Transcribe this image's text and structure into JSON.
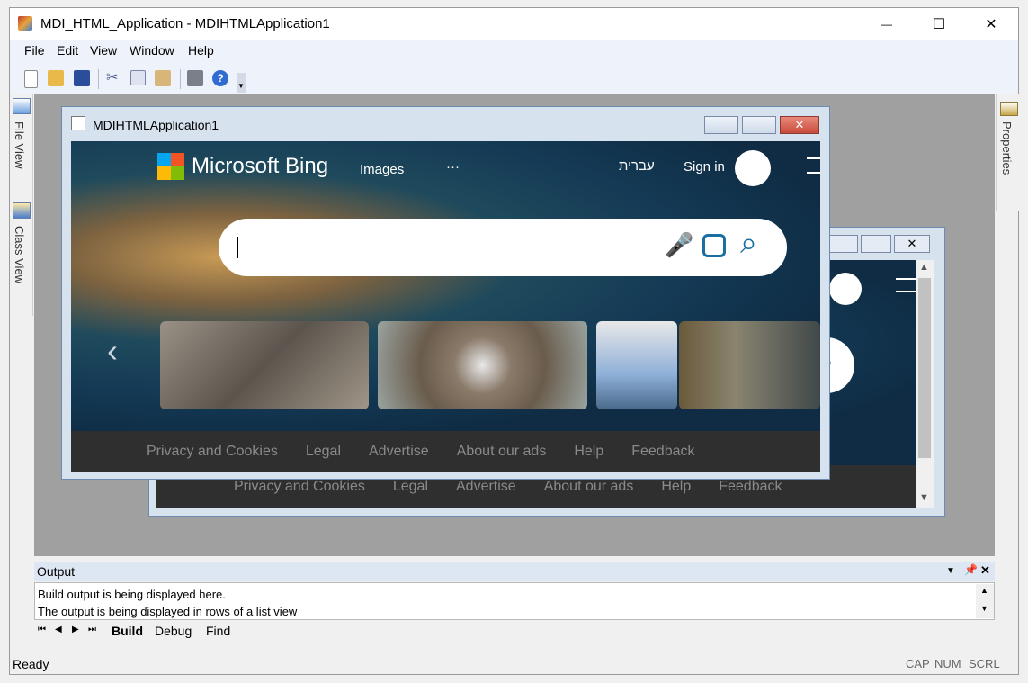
{
  "app": {
    "title": "MDI_HTML_Application - MDIHTMLApplication1",
    "minimize_glyph": "—",
    "maximize_glyph": "☐",
    "close_glyph": "✕"
  },
  "menu": [
    "File",
    "Edit",
    "View",
    "Window",
    "Help"
  ],
  "side_tabs": {
    "file_view": "File View",
    "class_view": "Class View",
    "properties": "Properties"
  },
  "child_front": {
    "title": "MDIHTMLApplication1",
    "bing": {
      "logo_text": "Microsoft Bing",
      "nav_images": "Images",
      "nav_more": "···",
      "nav_hebrew": "עברית",
      "sign_in": "Sign in",
      "footer": [
        "Privacy and Cookies",
        "Legal",
        "Advertise",
        "About our ads",
        "Help",
        "Feedback"
      ]
    }
  },
  "child_back": {
    "footer": [
      "Privacy and Cookies",
      "Legal",
      "Advertise",
      "About our ads",
      "Help",
      "Feedback"
    ]
  },
  "output": {
    "title": "Output",
    "lines": [
      "Build output is being displayed here.",
      "The output is being displayed in rows of a list view"
    ],
    "tabs": [
      "Build",
      "Debug",
      "Find"
    ]
  },
  "status": {
    "text": "Ready",
    "indicators": [
      "CAP",
      "NUM",
      "SCRL"
    ]
  },
  "colors": {
    "accent": "#1a5ea8",
    "close_red": "#c94a3c",
    "bing_blue": "#1a6fa0"
  }
}
